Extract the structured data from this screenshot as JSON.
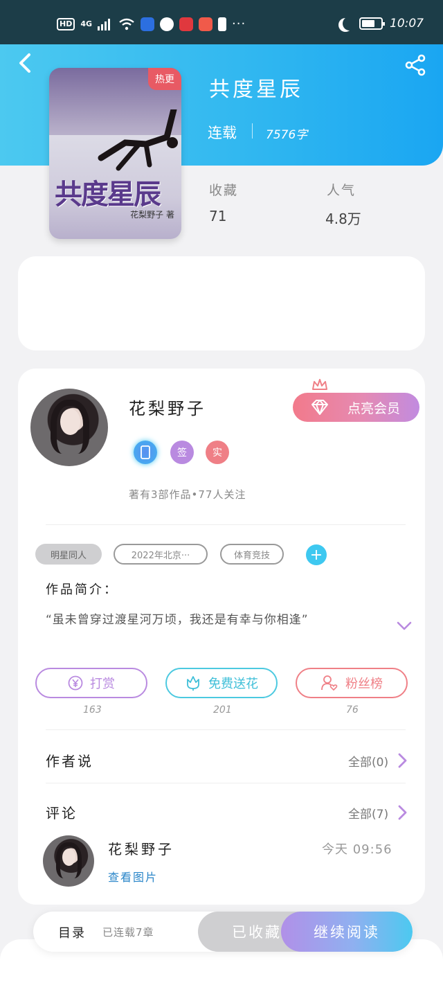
{
  "status_bar": {
    "network": "4G",
    "hd": "HD",
    "time": "10:07"
  },
  "book": {
    "title": "共度星辰",
    "status": "连载",
    "word_count": "7576字",
    "cover_badge": "热更",
    "cover_title": "共度星辰",
    "cover_author": "花梨野子 著"
  },
  "stats": {
    "favorites_label": "收藏",
    "favorites_value": "71",
    "popularity_label": "人气",
    "popularity_value": "4.8万"
  },
  "author": {
    "name": "花梨野子",
    "vip_button": "点亮会员",
    "badge_sign": "签",
    "badge_real": "实",
    "works_info": "著有3部作品•77人关注"
  },
  "tags": [
    "明星同人",
    "2022年北京···",
    "体育竞技"
  ],
  "intro": {
    "label": "作品简介：",
    "text": "“虽未曾穿过渡星河万顷，我还是有幸与你相逢”"
  },
  "actions": [
    {
      "label": "打赏",
      "count": "163",
      "color": "#b98ae0"
    },
    {
      "label": "免费送花",
      "count": "201",
      "color": "#4cc9e0"
    },
    {
      "label": "粉丝榜",
      "count": "76",
      "color": "#ef7f86"
    }
  ],
  "author_says": {
    "title": "作者说",
    "link": "全部(0)"
  },
  "comments": {
    "title": "评论",
    "link": "全部(7)",
    "items": [
      {
        "user": "花梨野子",
        "time": "今天 09:56",
        "link": "查看图片"
      }
    ]
  },
  "bottom_bar": {
    "toc": "目录",
    "chapters": "已连载7章",
    "favorited": "已收藏",
    "continue": "继续阅读"
  }
}
